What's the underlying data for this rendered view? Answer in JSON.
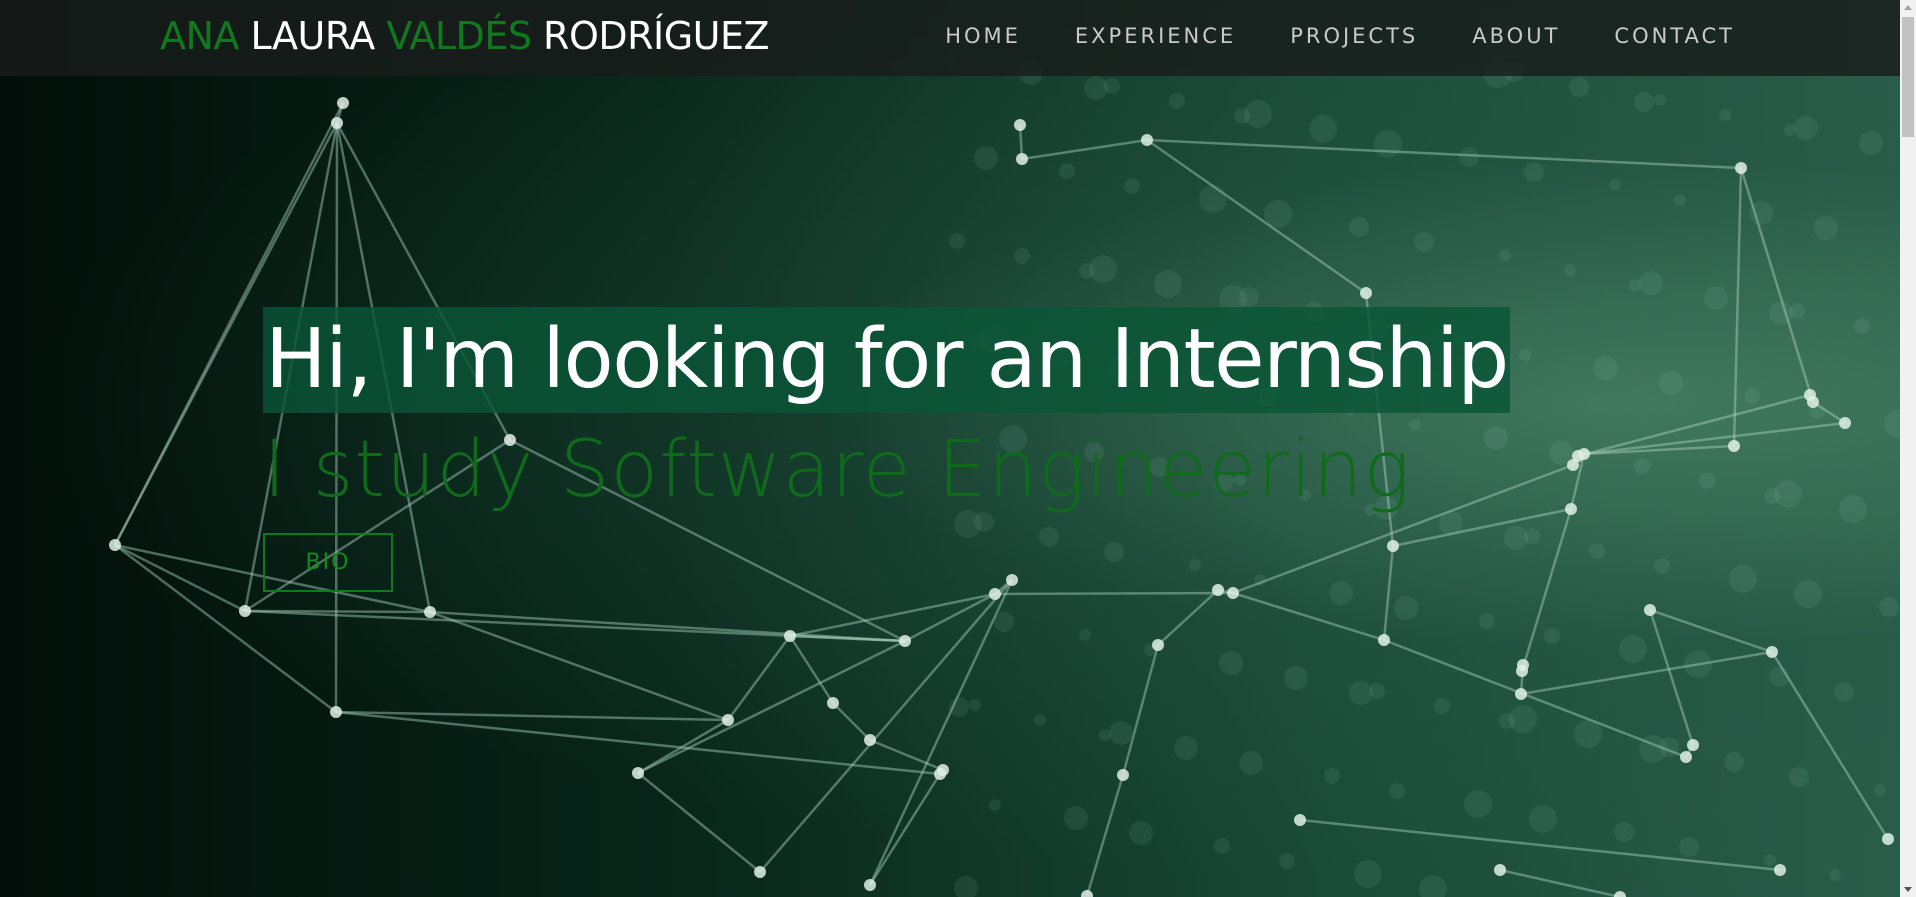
{
  "header": {
    "brand": {
      "part1": "ANA",
      "part2": "LAURA",
      "part3": "VALDÉS",
      "part4": "RODRÍGUEZ"
    },
    "nav": [
      {
        "label": "HOME"
      },
      {
        "label": "EXPERIENCE"
      },
      {
        "label": "PROJECTS"
      },
      {
        "label": "ABOUT"
      },
      {
        "label": "CONTACT"
      }
    ]
  },
  "hero": {
    "headline": "Hi, I'm looking for an Internship",
    "subline": "I study Software Engineering",
    "bio_button": "BIO"
  },
  "colors": {
    "accent_green": "#0f7a1d",
    "headline_bg": "#0a5537",
    "navbar_bg": "#191c1b"
  }
}
